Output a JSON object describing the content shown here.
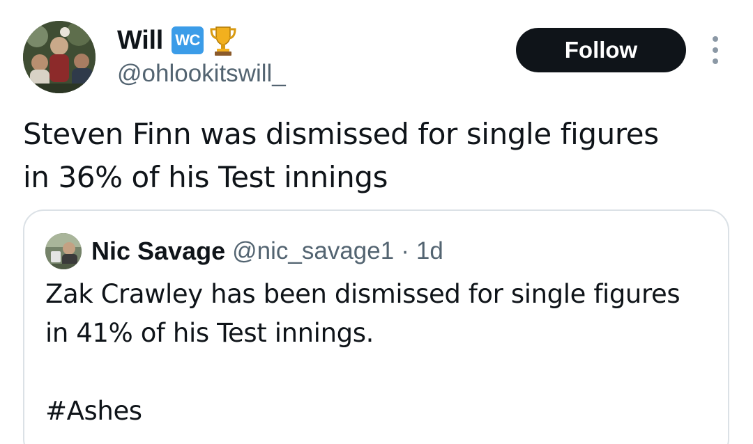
{
  "author": {
    "display_name": "Will",
    "badge_text": "WC",
    "trophy_icon": "trophy-emoji",
    "handle": "@ohlookitswill_"
  },
  "actions": {
    "follow_label": "Follow",
    "more_icon": "more-vertical-icon"
  },
  "tweet": {
    "line1": "Steven Finn was dismissed for single figures",
    "line2": "in 36% of his Test innings"
  },
  "quoted_tweet": {
    "display_name": "Nic Savage",
    "handle": "@nic_savage1",
    "separator": "·",
    "time": "1d",
    "line1": "Zak Crawley has been dismissed for single figures",
    "line2": "in 41% of his Test innings.",
    "hashtag": "#Ashes"
  },
  "colors": {
    "text_primary": "#0f1419",
    "text_secondary": "#536471",
    "follow_bg": "#0f1419",
    "badge_bg": "#3b9ce8",
    "card_border": "#dbe1e6"
  }
}
